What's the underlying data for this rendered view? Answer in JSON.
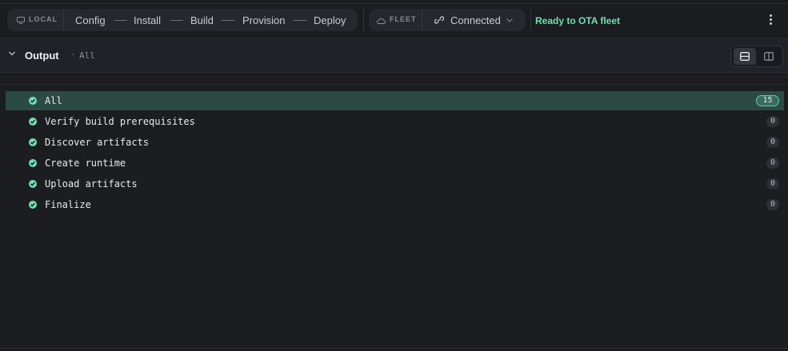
{
  "toolbar": {
    "local_tag": "LOCAL",
    "steps": [
      "Config",
      "Install",
      "Build",
      "Provision",
      "Deploy"
    ],
    "fleet_tag": "FLEET",
    "connection": "Connected",
    "status": "Ready to OTA fleet"
  },
  "output": {
    "title": "Output",
    "separator": "·",
    "filter": "All",
    "rows": [
      {
        "label": "All",
        "count": "15",
        "selected": true
      },
      {
        "label": "Verify build prerequisites",
        "count": "0"
      },
      {
        "label": "Discover artifacts",
        "count": "0"
      },
      {
        "label": "Create runtime",
        "count": "0"
      },
      {
        "label": "Upload artifacts",
        "count": "0"
      },
      {
        "label": "Finalize",
        "count": "0"
      }
    ]
  },
  "colors": {
    "accent": "#6fe0b2",
    "selected_row": "#2b4a44",
    "background": "#1c1d21"
  },
  "icons": [
    "monitor-icon",
    "cloud-icon",
    "link-icon",
    "chevron-down-icon",
    "more-vertical-icon",
    "check-circle-icon",
    "rows-layout-icon",
    "columns-layout-icon"
  ]
}
